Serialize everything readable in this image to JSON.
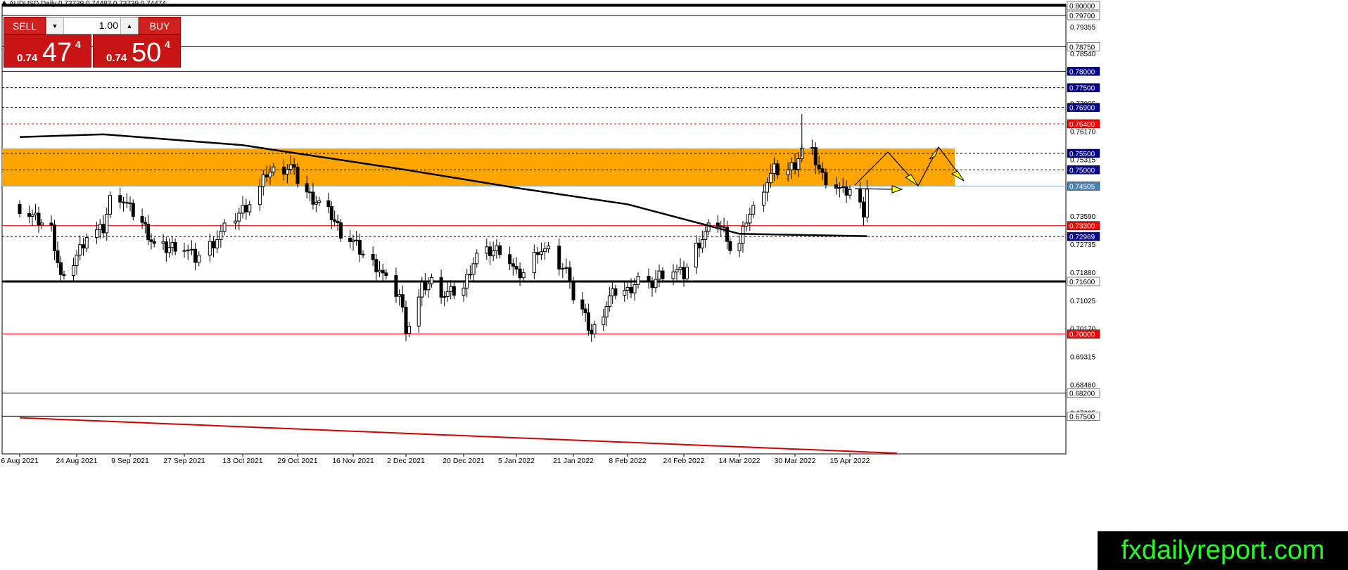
{
  "header": {
    "symbol_line": "AUDUSD,Daily  0.73739 0.74482 0.73739 0.74474"
  },
  "trade_panel": {
    "sell_label": "SELL",
    "buy_label": "BUY",
    "lot_value": "1.00",
    "sell_price": {
      "prefix": "0.74",
      "big": "47",
      "sup": "4"
    },
    "buy_price": {
      "prefix": "0.74",
      "big": "50",
      "sup": "4"
    }
  },
  "watermark": "fxdailyreport.com",
  "colors": {
    "zone": "#ffa500",
    "bear": "#000000",
    "label_blue": "#00008b",
    "label_red": "#ff0000",
    "label_gray": "#4682b4",
    "watermark_bg": "#000000",
    "watermark_fg": "#22ff22"
  },
  "chart_data": {
    "type": "candlestick",
    "symbol": "AUDUSD",
    "timeframe": "Daily",
    "ylim": [
      0.6684,
      0.8
    ],
    "x_tick_labels": [
      "6 Aug 2021",
      "24 Aug 2021",
      "9 Sep 2021",
      "27 Sep 2021",
      "13 Oct 2021",
      "29 Oct 2021",
      "16 Nov 2021",
      "2 Dec 2021",
      "20 Dec 2021",
      "5 Jan 2022",
      "21 Jan 2022",
      "8 Feb 2022",
      "24 Feb 2022",
      "14 Mar 2022",
      "30 Mar 2022",
      "15 Apr 2022"
    ],
    "y_tick_labels": [
      "0.79355",
      "0.78540",
      "0.77025",
      "0.76170",
      "0.75315",
      "0.73590",
      "0.72735",
      "0.71880",
      "0.71025",
      "0.70170",
      "0.69315",
      "0.68460",
      "0.67605"
    ],
    "price_levels": [
      {
        "value": 0.8,
        "label": "0.80000",
        "style": "solid-thick",
        "color": "#000000",
        "tag": "black"
      },
      {
        "value": 0.797,
        "label": "0.79700",
        "style": "solid",
        "color": "#000000",
        "tag": "black"
      },
      {
        "value": 0.7875,
        "label": "0.78750",
        "style": "solid",
        "color": "#000000",
        "tag": "black"
      },
      {
        "value": 0.78,
        "label": "0.78000",
        "style": "solid",
        "color": "#0000cd",
        "tag": "blue"
      },
      {
        "value": 0.775,
        "label": "0.77500",
        "style": "dashed",
        "color": "#000000",
        "tag": "blue"
      },
      {
        "value": 0.769,
        "label": "0.76900",
        "style": "dashed",
        "color": "#000000",
        "tag": "blue"
      },
      {
        "value": 0.764,
        "label": "0.76400",
        "style": "dashed",
        "color": "#ff0000",
        "tag": "red"
      },
      {
        "value": 0.755,
        "label": "0.75500",
        "style": "dashed",
        "color": "#000000",
        "tag": "blue"
      },
      {
        "value": 0.75,
        "label": "0.75000",
        "style": "dashed",
        "color": "#000000",
        "tag": "blue"
      },
      {
        "value": 0.74505,
        "label": "0.74505",
        "style": "solid",
        "color": "#87a9c9",
        "tag": "gray"
      },
      {
        "value": 0.733,
        "label": "0.73300",
        "style": "solid",
        "color": "#ff0000",
        "tag": "red"
      },
      {
        "value": 0.72969,
        "label": "0.72969",
        "style": "dashed",
        "color": "#000000",
        "tag": "blue"
      },
      {
        "value": 0.716,
        "label": "0.71600",
        "style": "solid-thick",
        "color": "#000000",
        "tag": "black"
      },
      {
        "value": 0.7,
        "label": "0.70000",
        "style": "solid",
        "color": "#ff0000",
        "tag": "red"
      },
      {
        "value": 0.682,
        "label": "0.68200",
        "style": "solid",
        "color": "#000000",
        "tag": "black"
      },
      {
        "value": 0.675,
        "label": "0.67500",
        "style": "solid",
        "color": "#000000",
        "tag": "black"
      }
    ],
    "zone": {
      "from": 0.745,
      "to": 0.7565
    },
    "ohlc_anchors": [
      [
        "6 Aug 2021",
        0.7385
      ],
      [
        "11 Aug 2021",
        0.735
      ],
      [
        "16 Aug 2021",
        0.732
      ],
      [
        "19 Aug 2021",
        0.7175
      ],
      [
        "20 Aug 2021",
        0.716
      ],
      [
        "24 Aug 2021",
        0.724
      ],
      [
        "27 Aug 2021",
        0.73
      ],
      [
        "1 Sep 2021",
        0.732
      ],
      [
        "3 Sep 2021",
        0.741
      ],
      [
        "6 Sep 2021",
        0.742
      ],
      [
        "9 Sep 2021",
        0.738
      ],
      [
        "13 Sep 2021",
        0.734
      ],
      [
        "17 Sep 2021",
        0.727
      ],
      [
        "21 Sep 2021",
        0.726
      ],
      [
        "24 Sep 2021",
        0.727
      ],
      [
        "27 Sep 2021",
        0.726
      ],
      [
        "30 Sep 2021",
        0.723
      ],
      [
        "5 Oct 2021",
        0.728
      ],
      [
        "8 Oct 2021",
        0.732
      ],
      [
        "13 Oct 2021",
        0.738
      ],
      [
        "17 Oct 2021",
        0.742
      ],
      [
        "20 Oct 2021",
        0.749
      ],
      [
        "23 Oct 2021",
        0.75
      ],
      [
        "27 Oct 2021",
        0.751
      ],
      [
        "29 Oct 2021",
        0.747
      ],
      [
        "2 Nov 2021",
        0.742
      ],
      [
        "5 Nov 2021",
        0.74
      ],
      [
        "9 Nov 2021",
        0.736
      ],
      [
        "12 Nov 2021",
        0.731
      ],
      [
        "16 Nov 2021",
        0.728
      ],
      [
        "20 Nov 2021",
        0.723
      ],
      [
        "24 Nov 2021",
        0.72
      ],
      [
        "27 Nov 2021",
        0.714
      ],
      [
        "30 Nov 2021",
        0.712
      ],
      [
        "2 Dec 2021",
        0.702
      ],
      [
        "4 Dec 2021",
        0.704
      ],
      [
        "7 Dec 2021",
        0.714
      ],
      [
        "10 Dec 2021",
        0.716
      ],
      [
        "14 Dec 2021",
        0.712
      ],
      [
        "17 Dec 2021",
        0.713
      ],
      [
        "20 Dec 2021",
        0.714
      ],
      [
        "22 Dec 2021",
        0.72
      ],
      [
        "24 Dec 2021",
        0.724
      ],
      [
        "28 Dec 2021",
        0.725
      ],
      [
        "31 Dec 2021",
        0.726
      ],
      [
        "3 Jan 2022",
        0.722
      ],
      [
        "5 Jan 2022",
        0.718
      ],
      [
        "8 Jan 2022",
        0.719
      ],
      [
        "11 Jan 2022",
        0.726
      ],
      [
        "14 Jan 2022",
        0.725
      ],
      [
        "17 Jan 2022",
        0.721
      ],
      [
        "20 Jan 2022",
        0.718
      ],
      [
        "21 Jan 2022",
        0.711
      ],
      [
        "24 Jan 2022",
        0.707
      ],
      [
        "27 Jan 2022",
        0.7
      ],
      [
        "30 Jan 2022",
        0.705
      ],
      [
        "2 Feb 2022",
        0.711
      ],
      [
        "5 Feb 2022",
        0.714
      ],
      [
        "8 Feb 2022",
        0.713
      ],
      [
        "11 Feb 2022",
        0.717
      ],
      [
        "14 Feb 2022",
        0.714
      ],
      [
        "17 Feb 2022",
        0.718
      ],
      [
        "20 Feb 2022",
        0.72
      ],
      [
        "24 Feb 2022",
        0.718
      ],
      [
        "27 Feb 2022",
        0.725
      ],
      [
        "1 Mar 2022",
        0.728
      ],
      [
        "4 Mar 2022",
        0.732
      ],
      [
        "7 Mar 2022",
        0.734
      ],
      [
        "10 Mar 2022",
        0.73
      ],
      [
        "12 Mar 2022",
        0.722
      ],
      [
        "14 Mar 2022",
        0.727
      ],
      [
        "16 Mar 2022",
        0.735
      ],
      [
        "18 Mar 2022",
        0.738
      ],
      [
        "21 Mar 2022",
        0.745
      ],
      [
        "24 Mar 2022",
        0.75
      ],
      [
        "27 Mar 2022",
        0.749
      ],
      [
        "30 Mar 2022",
        0.752
      ],
      [
        "2 Apr 2022",
        0.758
      ],
      [
        "4 Apr 2022",
        0.755
      ],
      [
        "7 Apr 2022",
        0.748
      ],
      [
        "11 Apr 2022",
        0.745
      ],
      [
        "13 Apr 2022",
        0.743
      ],
      [
        "15 Apr 2022",
        0.744
      ],
      [
        "18 Apr 2022",
        0.739
      ],
      [
        "19 Apr 2022",
        0.7374
      ],
      [
        "20 Apr 2022",
        0.7447
      ]
    ],
    "moving_average": [
      [
        "6 Aug 2021",
        0.76
      ],
      [
        "1 Sep 2021",
        0.7608
      ],
      [
        "13 Oct 2021",
        0.7575
      ],
      [
        "2 Dec 2021",
        0.75
      ],
      [
        "5 Jan 2022",
        0.7445
      ],
      [
        "8 Feb 2022",
        0.7395
      ],
      [
        "14 Mar 2022",
        0.7305
      ],
      [
        "20 Apr 2022",
        0.7298
      ]
    ],
    "bottom_trendline": [
      [
        "6 Aug 2021",
        0.6745
      ],
      [
        "20 Apr 2022",
        0.6655
      ]
    ],
    "projection": [
      {
        "type": "arrow",
        "color": "#000000",
        "points": [
          [
            0.745,
            0
          ],
          [
            0.749,
            1
          ],
          [
            0.755,
            2
          ],
          [
            0.7465,
            3
          ],
          [
            0.757,
            4
          ],
          [
            0.746,
            5
          ]
        ]
      },
      {
        "type": "arrow",
        "color": "#000000",
        "points": [
          [
            0.745,
            0
          ],
          [
            0.745,
            1
          ]
        ]
      }
    ]
  }
}
